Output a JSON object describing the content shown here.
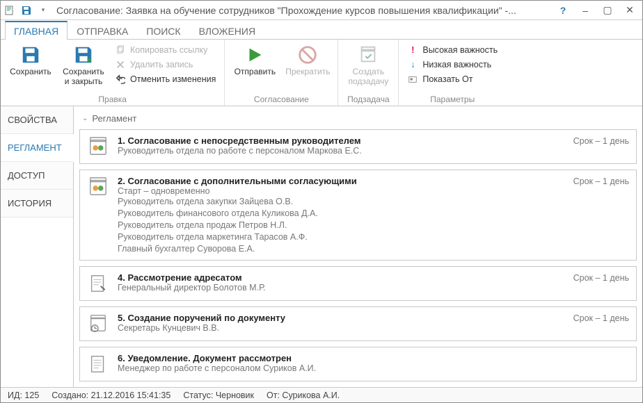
{
  "window": {
    "title": "Согласование: Заявка на обучение сотрудников \"Прохождение курсов повышения квалификации\" -..."
  },
  "tabs": {
    "main": "ГЛАВНАЯ",
    "send": "ОТПРАВКА",
    "search": "ПОИСК",
    "attachments": "ВЛОЖЕНИЯ"
  },
  "ribbon": {
    "save": "Сохранить",
    "save_close": "Сохранить и закрыть",
    "copy_link": "Копировать ссылку",
    "delete_record": "Удалить запись",
    "undo_changes": "Отменить изменения",
    "group_edit": "Правка",
    "send_btn": "Отправить",
    "stop_btn": "Прекратить",
    "group_approval": "Согласование",
    "create_subtask": "Создать подзадачу",
    "group_subtask": "Подзадача",
    "high_priority": "Высокая важность",
    "low_priority": "Низкая важность",
    "show_from": "Показать От",
    "group_params": "Параметры"
  },
  "sidetabs": {
    "properties": "СВОЙСТВА",
    "reglament": "РЕГЛАМЕНТ",
    "access": "ДОСТУП",
    "history": "ИСТОРИЯ"
  },
  "section_title": "Регламент",
  "steps": [
    {
      "title": "1. Согласование с непосредственным руководителем",
      "info": "Руководитель отдела по работе с персоналом Маркова Е.С.",
      "term": "Срок – 1 день",
      "icon": "approval"
    },
    {
      "title": "2. Согласование с дополнительными согласующими",
      "info": "Старт – одновременно",
      "lines": [
        "Руководитель отдела закупки Зайцева О.В.",
        "Руководитель финансового отдела Куликова Д.А.",
        "Руководитель отдела продаж Петров Н.Л.",
        "Руководитель отдела маркетинга Тарасов А.Ф.",
        "Главный бухгалтер Суворова Е.А."
      ],
      "term": "Срок – 1 день",
      "icon": "approval"
    },
    {
      "title": "4. Рассмотрение адресатом",
      "info": "Генеральный директор Болотов М.Р.",
      "term": "Срок – 1 день",
      "icon": "review"
    },
    {
      "title": "5. Создание поручений по документу",
      "info": "Секретарь Кунцевич В.В.",
      "term": "Срок – 1 день",
      "icon": "task"
    },
    {
      "title": "6. Уведомление. Документ рассмотрен",
      "info": "Менеджер по работе с персоналом Суриков А.И.",
      "term": "",
      "icon": "notify"
    }
  ],
  "status": {
    "id_label": "ИД:",
    "id_value": "125",
    "created_label": "Создано:",
    "created_value": "21.12.2016 15:41:35",
    "status_label": "Статус:",
    "status_value": "Черновик",
    "from_label": "От:",
    "from_value": "Сурикова А.И."
  }
}
